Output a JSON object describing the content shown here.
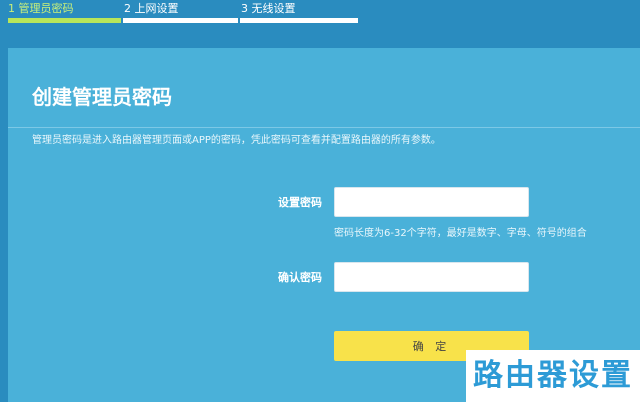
{
  "steps": [
    {
      "label": "1 管理员密码",
      "active": true
    },
    {
      "label": "2 上网设置",
      "active": false
    },
    {
      "label": "3 无线设置",
      "active": false
    }
  ],
  "panel": {
    "title": "创建管理员密码",
    "description": "管理员密码是进入路由器管理页面或APP的密码，凭此密码可查看并配置路由器的所有参数。"
  },
  "form": {
    "password_label": "设置密码",
    "password_value": "",
    "password_hint": "密码长度为6-32个字符，最好是数字、字母、符号的组合",
    "confirm_label": "确认密码",
    "confirm_value": "",
    "submit_label": "确 定"
  },
  "watermark": "路由器设置",
  "colors": {
    "header_bg": "#2a8cbf",
    "panel_bg": "#4ab1d9",
    "active_step": "#b8e65a",
    "button": "#f8e24a",
    "watermark_text": "#2d9bd6"
  }
}
